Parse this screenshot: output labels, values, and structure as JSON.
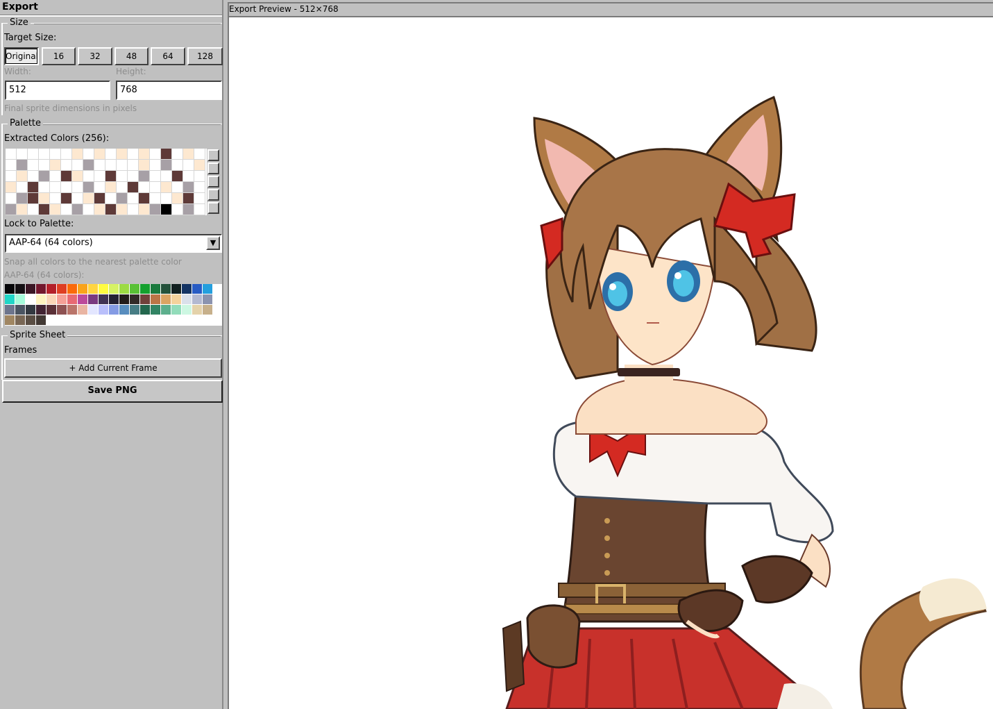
{
  "window": {
    "title": "Export"
  },
  "size": {
    "legend": "Size",
    "target_label": "Target Size:",
    "buttons": [
      "Original",
      "16",
      "32",
      "48",
      "64",
      "128"
    ],
    "selected": "Original",
    "width_label": "Width:",
    "height_label": "Height:",
    "width_value": "512",
    "height_value": "768",
    "hint": "Final sprite dimensions in pixels"
  },
  "palette": {
    "legend": "Palette",
    "extracted_label": "Extracted Colors (256):",
    "lock_label": "Lock to Palette:",
    "lock_value": "AAP-64 (64 colors)",
    "snap_hint": "Snap all colors to the nearest palette color",
    "palette_name": "AAP-64 (64 colors):",
    "extracted_swatches": [
      "#ffffff",
      "#ffffff",
      "#ffffff",
      "#ffffff",
      "#ffffff",
      "#ffffff",
      "#fde8d0",
      "#ffffff",
      "#fde8d0",
      "#ffffff",
      "#fde8d0",
      "#ffffff",
      "#fde8d0",
      "#ffffff",
      "#5e3a38",
      "#ffffff",
      "#fde8d0",
      "#ffffff",
      "#ffffff",
      "#a7a0a6",
      "#ffffff",
      "#ffffff",
      "#fde8d0",
      "#ffffff",
      "#ffffff",
      "#a7a0a6",
      "#ffffff",
      "#ffffff",
      "#ffffff",
      "#ffffff",
      "#fde8d0",
      "#ffffff",
      "#a7a0a6",
      "#ffffff",
      "#ffffff",
      "#fde8d0",
      "#ffffff",
      "#fde8d0",
      "#ffffff",
      "#a7a0a6",
      "#ffffff",
      "#5e3a38",
      "#fde8d0",
      "#ffffff",
      "#ffffff",
      "#5e3a38",
      "#ffffff",
      "#ffffff",
      "#a7a0a6",
      "#ffffff",
      "#ffffff",
      "#5e3a38",
      "#ffffff",
      "#ffffff",
      "#fde8d0",
      "#ffffff",
      "#5e3a38",
      "#ffffff",
      "#ffffff",
      "#ffffff",
      "#ffffff",
      "#a7a0a6",
      "#ffffff",
      "#fde8d0",
      "#ffffff",
      "#5e3a38",
      "#ffffff",
      "#ffffff",
      "#fde8d0",
      "#ffffff",
      "#a7a0a6",
      "#ffffff",
      "#ffffff",
      "#a7a0a6",
      "#5e3a38",
      "#fde8d0",
      "#ffffff",
      "#5e3a38",
      "#ffffff",
      "#fde8d0",
      "#5e3a38",
      "#ffffff",
      "#a7a0a6",
      "#ffffff",
      "#5e3a38",
      "#ffffff",
      "#ffffff",
      "#fde8d0",
      "#5e3a38",
      "#ffffff",
      "#a7a0a6",
      "#fde8d0",
      "#ffffff",
      "#5e3a38",
      "#fde8d0",
      "#ffffff",
      "#a7a0a6",
      "#ffffff",
      "#fde8d0",
      "#5e3a38",
      "#fde8d0",
      "#ffffff",
      "#fde8d0",
      "#a7a0a6",
      "#000000",
      "#ffffff",
      "#a7a0a6",
      "#ffffff"
    ],
    "aap64": [
      "#060608",
      "#141013",
      "#3b1725",
      "#73172d",
      "#b4202a",
      "#df3e23",
      "#fa6a0a",
      "#f9a31b",
      "#ffd541",
      "#fffc40",
      "#d6f264",
      "#9cdb43",
      "#59c135",
      "#14a02e",
      "#1a7a3e",
      "#24523b",
      "#122020",
      "#143464",
      "#285cc4",
      "#249fde",
      "#20d6c7",
      "#a6fcdb",
      "#ffffff",
      "#fef3c0",
      "#fad6b8",
      "#f5a097",
      "#e86a73",
      "#bc4a9b",
      "#793a80",
      "#403353",
      "#242234",
      "#221c1a",
      "#322b28",
      "#71413b",
      "#bb7547",
      "#dba463",
      "#f4d29c",
      "#dae0ea",
      "#b3b9d1",
      "#8b93af",
      "#6d758d",
      "#4a5462",
      "#333941",
      "#422433",
      "#5b3138",
      "#8e5252",
      "#ba756a",
      "#e9b5a3",
      "#e3e6ff",
      "#b9bffb",
      "#849be4",
      "#588dbe",
      "#477d85",
      "#23674e",
      "#328464",
      "#5daf8d",
      "#92dcba",
      "#cdf7e2",
      "#e4d2aa",
      "#c7b08b",
      "#a08662",
      "#796755",
      "#5a4e44",
      "#423934"
    ]
  },
  "sprite_sheet": {
    "legend": "Sprite Sheet",
    "frames_label": "Frames",
    "add_frame": "+ Add Current Frame"
  },
  "save_button": "Save PNG",
  "preview": {
    "title": "Export Preview - 512×768"
  }
}
